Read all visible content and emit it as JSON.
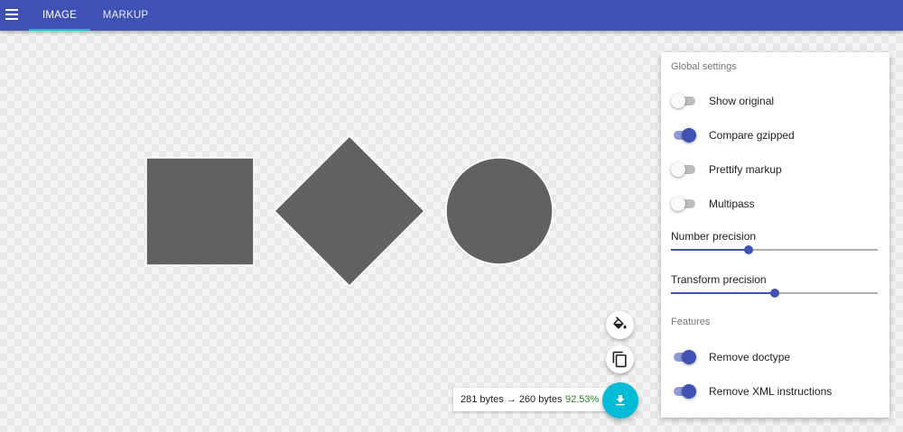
{
  "toolbar": {
    "menu_icon": "hamburger-menu-icon",
    "tabs": [
      {
        "label": "IMAGE",
        "active": true
      },
      {
        "label": "MARKUP",
        "active": false
      }
    ],
    "colors": {
      "bar": "#3f51b5",
      "indicator": "#00bcd4"
    }
  },
  "canvas": {
    "shapes": [
      "square",
      "diamond",
      "circle"
    ],
    "fill_color": "#616161",
    "stroke_color": "#ffffff"
  },
  "settings": {
    "global_title": "Global settings",
    "toggles": [
      {
        "label": "Show original",
        "on": false
      },
      {
        "label": "Compare gzipped",
        "on": true
      },
      {
        "label": "Prettify markup",
        "on": false
      },
      {
        "label": "Multipass",
        "on": false
      }
    ],
    "sliders": [
      {
        "label": "Number precision",
        "level": 0.375
      },
      {
        "label": "Transform precision",
        "level": 0.5
      }
    ],
    "features_title": "Features",
    "features": [
      {
        "label": "Remove doctype",
        "on": true
      },
      {
        "label": "Remove XML instructions",
        "on": true
      }
    ],
    "accent_color": "#3f51b5"
  },
  "actions": {
    "paint_bucket_icon": "paint-bucket-icon",
    "copy_icon": "copy-icon",
    "download_icon": "download-icon",
    "download_color": "#00bcd4"
  },
  "stats": {
    "sizes": "281 bytes → 260 bytes",
    "percent": "92.53%",
    "percent_color": "#2e7d32"
  }
}
